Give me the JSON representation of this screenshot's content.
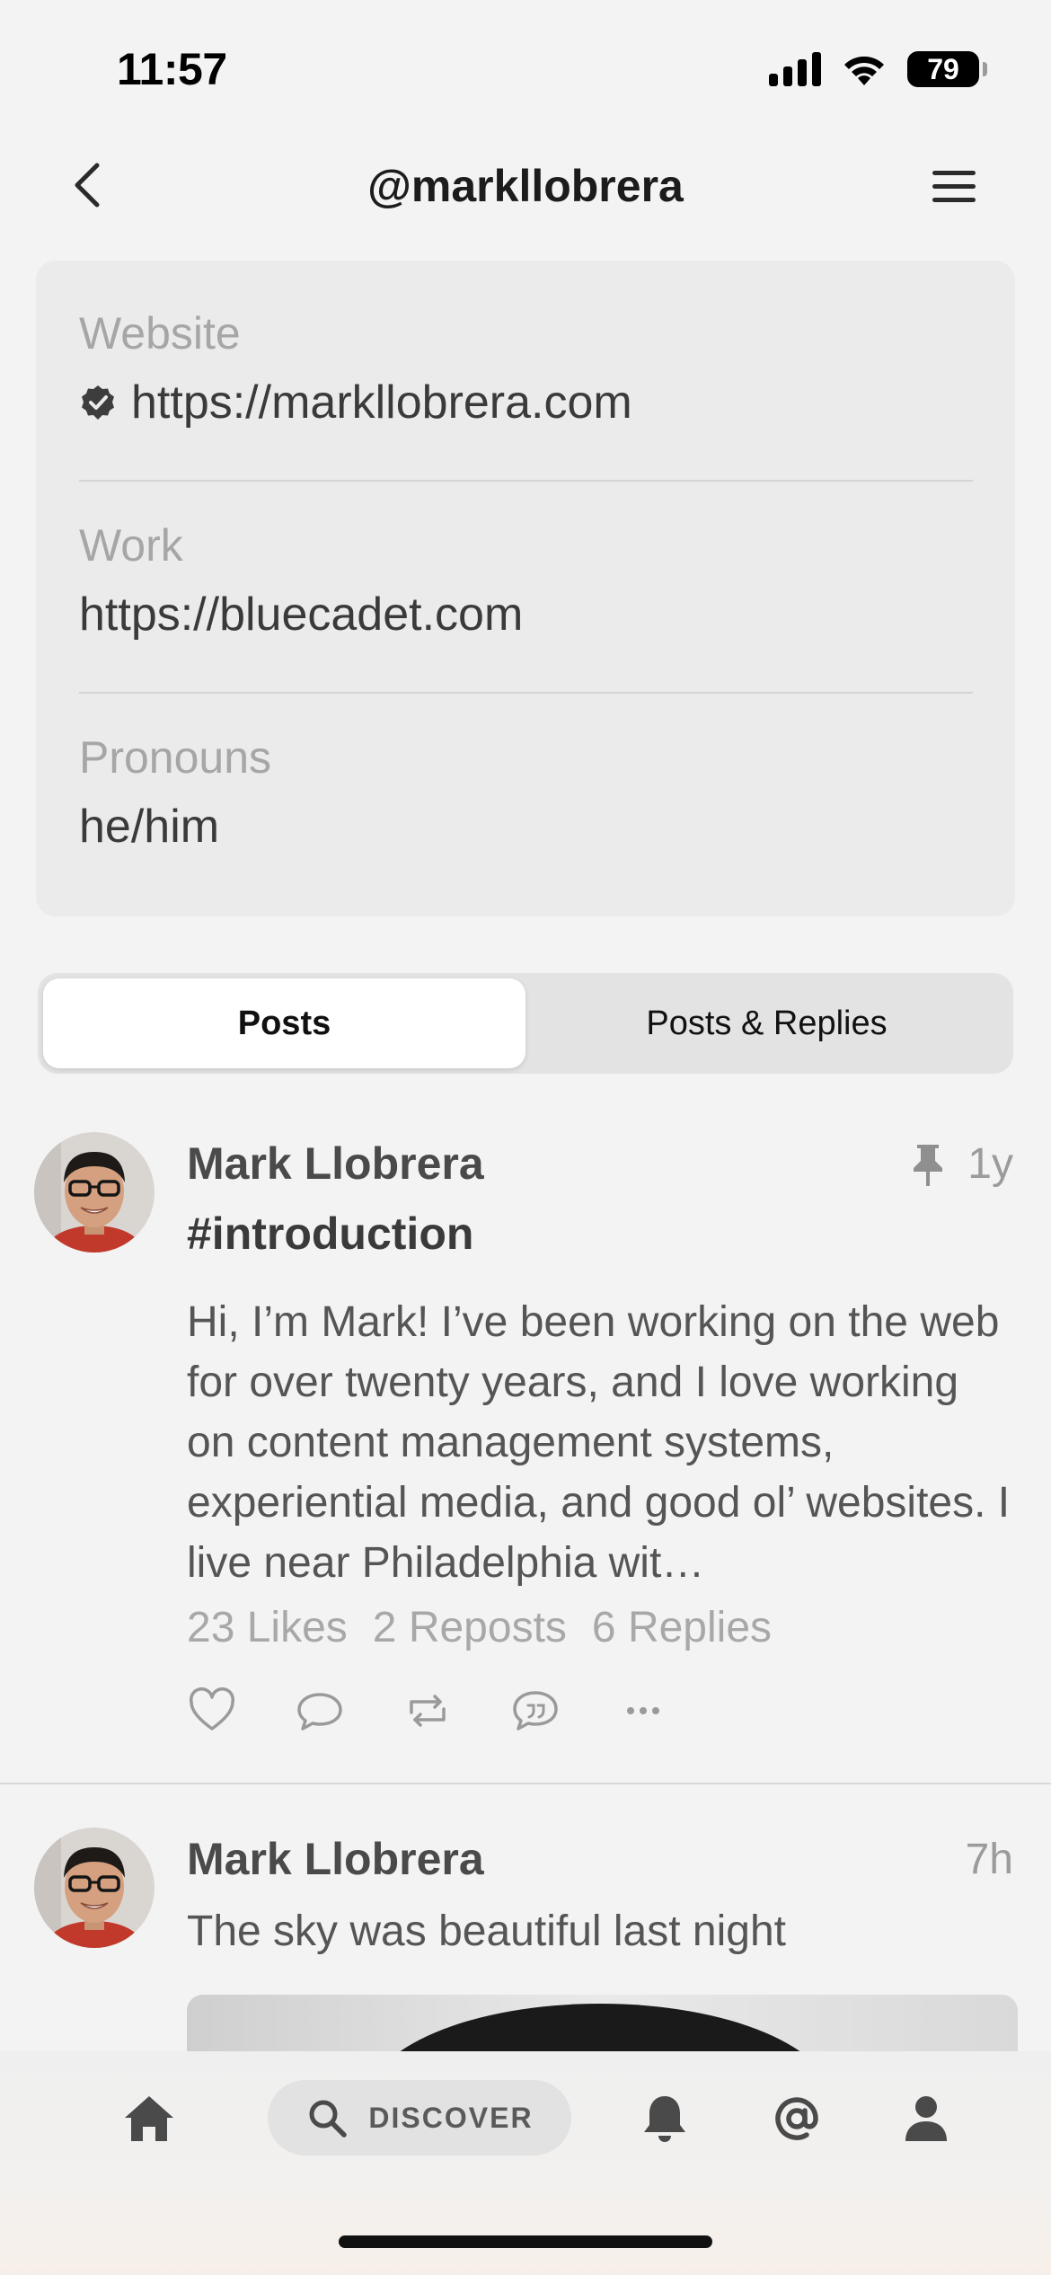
{
  "status": {
    "time": "11:57",
    "battery": "79"
  },
  "header": {
    "title": "@markllobrera"
  },
  "profile_fields": [
    {
      "label": "Website",
      "value": "https://markllobrera.com",
      "verified": true
    },
    {
      "label": "Work",
      "value": "https://bluecadet.com",
      "verified": false
    },
    {
      "label": "Pronouns",
      "value": "he/him",
      "verified": false
    }
  ],
  "tabs": [
    {
      "label": "Posts",
      "active": true
    },
    {
      "label": "Posts & Replies",
      "active": false
    }
  ],
  "posts": [
    {
      "author": "Mark Llobrera",
      "time": "1y",
      "pinned": true,
      "tag": "#introduction",
      "text": "Hi, I’m Mark! I’ve been working on the web for over twenty years, and I love working on content management systems, experiential media, and good ol’ websites. I live near Philadelphia wit…",
      "likes": "23 Likes",
      "reposts": "2 Reposts",
      "replies": "6 Replies"
    },
    {
      "author": "Mark Llobrera",
      "time": "7h",
      "pinned": false,
      "text": "The sky was beautiful last night"
    }
  ],
  "tab_bar": {
    "discover_label": "DISCOVER"
  },
  "colors": {
    "background": "#f3f3f3",
    "card": "#ebebeb",
    "muted": "#a6a6a6"
  }
}
